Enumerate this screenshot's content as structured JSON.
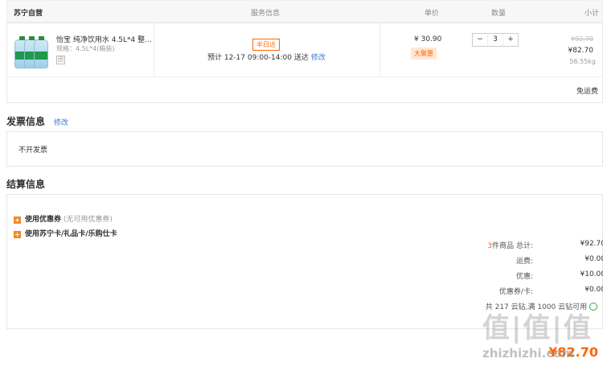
{
  "header": {
    "store": "苏宁自营",
    "service_col": "服务信息",
    "price_col": "单价",
    "qty_col": "数量",
    "subtotal_col": "小计"
  },
  "product": {
    "image_icon": "water-bottles-image",
    "name": "怡宝 纯净饮用水 4.5L*4 整...",
    "spec": "规格：4.5L*4(箱装)",
    "small_badge": "团",
    "service_tag": "半日达",
    "delivery": "预计 12-17 09:00-14:00 送达",
    "modify_link": "修改",
    "unit_price": "¥ 30.90",
    "sale_tag": "大聚惠",
    "qty_minus": "−",
    "qty_value": "3",
    "qty_plus": "+",
    "original_total": "¥92.70",
    "subtotal": "¥82.70",
    "weight": "56.55kg",
    "shipping_note": "免运费"
  },
  "invoice": {
    "title": "发票信息",
    "modify_link": "修改",
    "value": "不开发票"
  },
  "settlement": {
    "title": "结算信息",
    "coupon_label": "使用优惠券",
    "coupon_note": "(无可用优惠券)",
    "card_label": "使用苏宁卡/礼品卡/乐购仕卡",
    "items_count": "3",
    "items_label": "件商品 总计:",
    "items_total": "¥92.70",
    "shipping_label": "运费:",
    "shipping_value": "¥0.00",
    "discount_label": "优惠:",
    "discount_value": "¥10.00",
    "coupon_card_label": "优惠券/卡:",
    "coupon_card_value": "¥0.00",
    "points_line": "共 217 云钻,满 1000 云钻可用",
    "payable": "¥82.70"
  },
  "watermark": {
    "glyphs": "值|值|值",
    "site": "zhizhizhi.com"
  },
  "colors": {
    "accent": "#ff6600",
    "link": "#3b7bd4",
    "plus_icon": "#f08a24"
  }
}
